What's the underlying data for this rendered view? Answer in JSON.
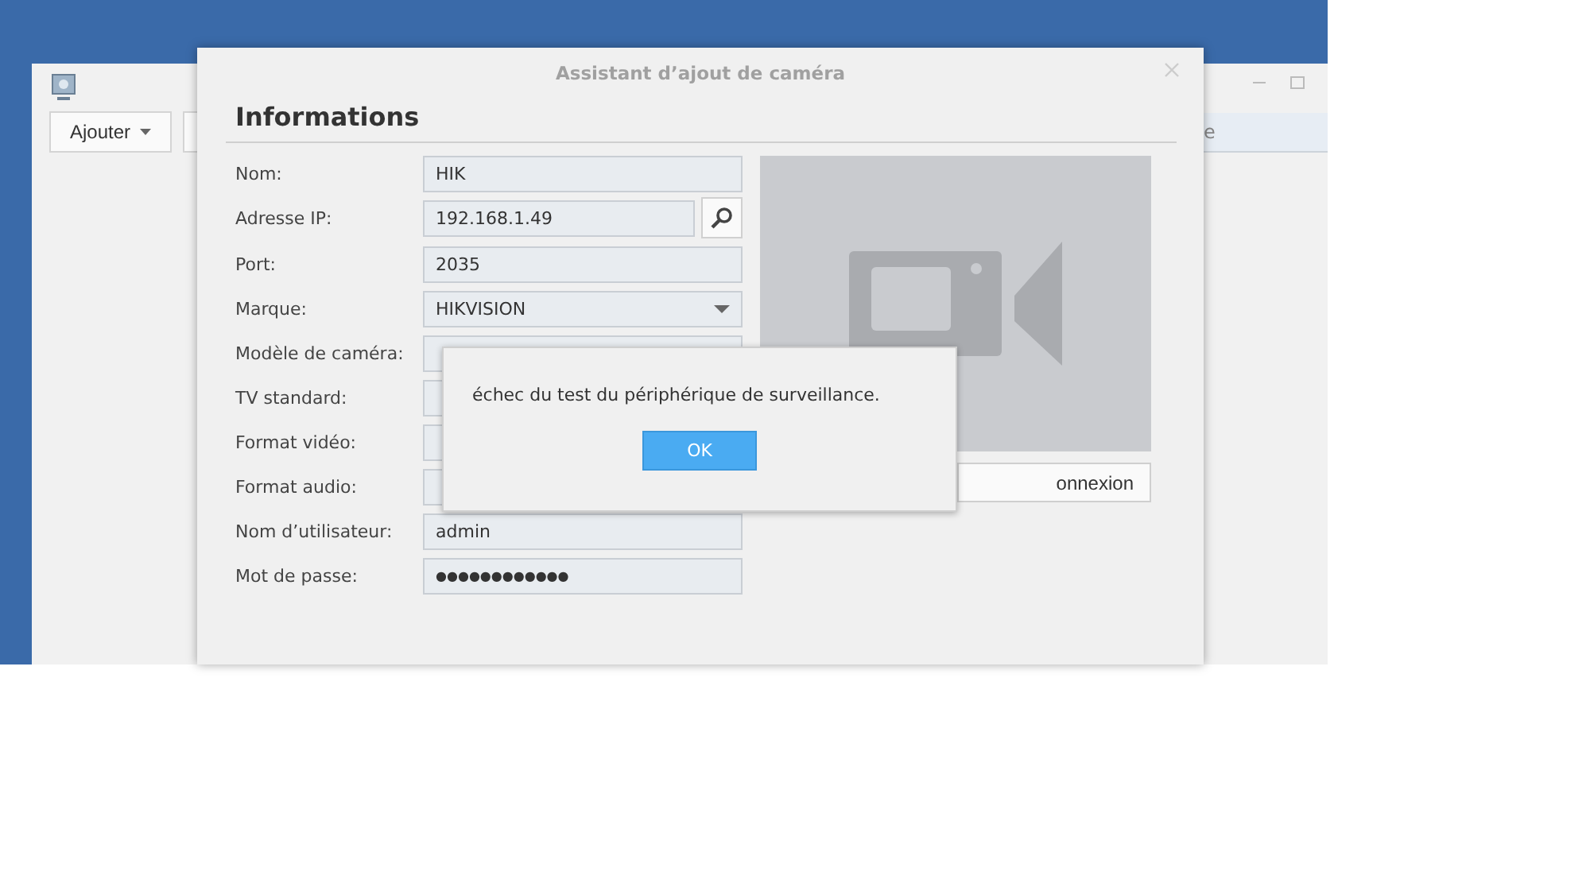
{
  "background_window": {
    "toolbar": [
      {
        "label": "Ajouter",
        "kind": "menu"
      },
      {
        "kind": "cut"
      }
    ],
    "column_header": "e"
  },
  "dialog": {
    "title": "Assistant d’ajout de caméra",
    "heading": "Informations",
    "fields": [
      {
        "label": "Nom:",
        "value": "HIK",
        "kind": "text"
      },
      {
        "label": "Adresse IP:",
        "value": "192.168.1.49",
        "kind": "search"
      },
      {
        "label": "Port:",
        "value": "2035",
        "kind": "text"
      },
      {
        "label": "Marque:",
        "value": "HIKVISION",
        "kind": "select"
      },
      {
        "label": "Modèle de caméra:",
        "kind": "text"
      },
      {
        "label": "TV standard:",
        "kind": "text"
      },
      {
        "label": "Format vidéo:",
        "kind": "text"
      },
      {
        "label": "Format audio:",
        "kind": "text"
      },
      {
        "label": "Nom d’utilisateur:",
        "value": "admin",
        "kind": "text"
      },
      {
        "label": "Mot de passe:",
        "value": "●●●●●●●●●●●●",
        "kind": "password"
      }
    ],
    "test_button": "onnexion"
  },
  "alert": {
    "message": "échec du test du périphérique de surveillance.",
    "button": "OK"
  }
}
